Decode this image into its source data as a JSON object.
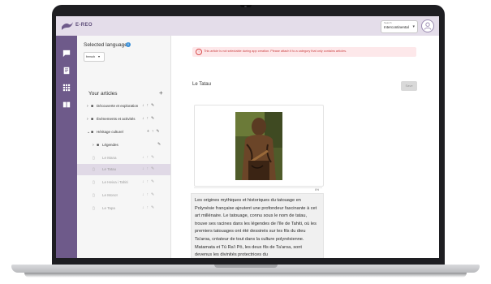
{
  "app": {
    "logo_text": "E-REO"
  },
  "search": {
    "label": "Search",
    "value": "Intercontinental"
  },
  "sidebar": {
    "selected_language_label": "Selected language",
    "info_icon": "i",
    "language_value": "french",
    "articles_title": "Your articles",
    "add_label": "+",
    "items": [
      {
        "label": "Découverte et exploration"
      },
      {
        "label": "Événements et activités"
      },
      {
        "label": "Héritage culturel"
      },
      {
        "label": "Légendes"
      },
      {
        "label": "Le Mana"
      },
      {
        "label": "Le Tatau"
      },
      {
        "label": "Le Heiva i Tahiti"
      },
      {
        "label": "Le Monoï"
      },
      {
        "label": "Le Tapa"
      }
    ]
  },
  "main": {
    "alert_text": "This article is not selectable during app creation. Please attach it to a category that only contains articles.",
    "article_title": "Le Tatau",
    "save_label": "Save",
    "image_tag": "6%",
    "body_text": "Les origines mythiques et historiques du tatouage en Polynésie française ajoutent une profondeur fascinante à cet art millénaire. Le tatouage, connu sous le nom de tatau, trouve ses racines dans les légendes de l'île de Tahiti, où les premiers tatouages ont été dessinés sur les fils du dieu Ta'aroa, créateur de tout dans la culture polynésienne. Matamata et Tū Ra'i Pō, les deux fils de Ta'aroa, sont devenus les divinités protectrices du"
  },
  "colors": {
    "rail": "#6e5a8a",
    "topbar": "#e4ddea",
    "selected_row": "#e0d9e6",
    "alert_bg": "#fde8ea",
    "alert_text": "#cc4444"
  }
}
